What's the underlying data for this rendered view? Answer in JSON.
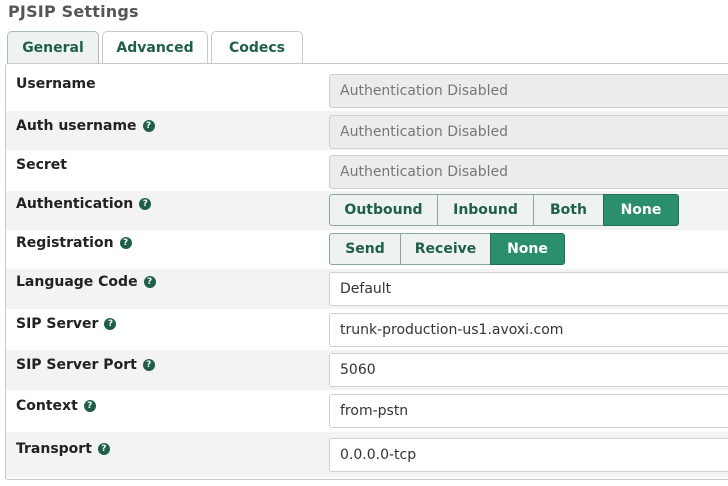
{
  "page_title": "PJSIP Settings",
  "tabs": [
    {
      "label": "General",
      "active": true
    },
    {
      "label": "Advanced",
      "active": false
    },
    {
      "label": "Codecs",
      "active": false
    }
  ],
  "fields": {
    "username": {
      "label": "Username",
      "value": "Authentication Disabled"
    },
    "auth_username": {
      "label": "Auth username",
      "value": "Authentication Disabled"
    },
    "secret": {
      "label": "Secret",
      "value": "Authentication Disabled"
    },
    "authentication": {
      "label": "Authentication",
      "options": [
        "Outbound",
        "Inbound",
        "Both",
        "None"
      ],
      "selected": "None"
    },
    "registration": {
      "label": "Registration",
      "options": [
        "Send",
        "Receive",
        "None"
      ],
      "selected": "None"
    },
    "language_code": {
      "label": "Language Code",
      "value": "Default"
    },
    "sip_server": {
      "label": "SIP Server",
      "value": "trunk-production-us1.avoxi.com"
    },
    "sip_server_port": {
      "label": "SIP Server Port",
      "value": "5060"
    },
    "context": {
      "label": "Context",
      "value": "from-pstn"
    },
    "transport": {
      "label": "Transport",
      "value": "0.0.0.0-tcp"
    }
  },
  "icons": {
    "help": "?"
  },
  "colors": {
    "accent": "#2a8f6a",
    "accent_dark": "#1f5f4a"
  }
}
